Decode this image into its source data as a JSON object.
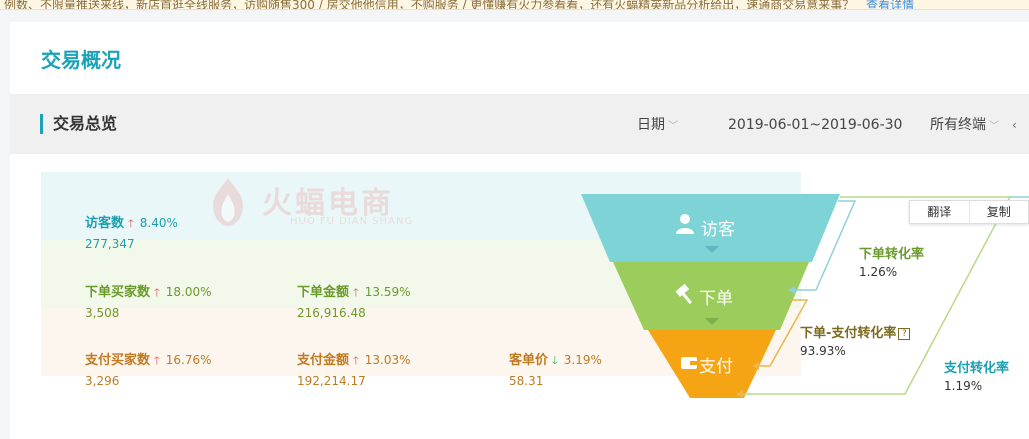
{
  "notice": {
    "text": "例数、不限量推送来线，新店首逛全线服务，访购随售300 / 房交他他信用，不购服务 / 更懂赚有火力参看看，还有火蝠精英新品分析给出，速通商交易意来事？",
    "link": "查看详情"
  },
  "page": {
    "title": "交易概况"
  },
  "section": {
    "title": "交易总览",
    "filters": {
      "date_label": "日期",
      "date_range": "2019-06-01~2019-06-30",
      "terminal": "所有终端"
    }
  },
  "watermark": {
    "title": "火蝠电商",
    "subtitle": "HUO FU DIAN SHANG"
  },
  "funnel": {
    "visitor": {
      "label": "访客",
      "color": "#7ed3d6"
    },
    "order": {
      "label": "下单",
      "color": "#9ccd5c"
    },
    "pay": {
      "label": "支付",
      "color": "#f5a414"
    }
  },
  "metrics": {
    "visitor": [
      {
        "label": "访客数",
        "direction": "up",
        "pct": "8.40%",
        "value": "277,347"
      }
    ],
    "order": [
      {
        "label": "下单买家数",
        "direction": "up",
        "pct": "18.00%",
        "value": "3,508"
      },
      {
        "label": "下单金额",
        "direction": "up",
        "pct": "13.59%",
        "value": "216,916.48"
      }
    ],
    "pay": [
      {
        "label": "支付买家数",
        "direction": "up",
        "pct": "16.76%",
        "value": "3,296"
      },
      {
        "label": "支付金额",
        "direction": "up",
        "pct": "13.03%",
        "value": "192,214.17"
      },
      {
        "label": "客单价",
        "direction": "down",
        "pct": "3.19%",
        "value": "58.31"
      }
    ]
  },
  "conversion": {
    "order_rate": {
      "label": "下单转化率",
      "value": "1.26%"
    },
    "order_to_pay_rate": {
      "label": "下单-支付转化率",
      "value": "93.93%"
    },
    "pay_rate": {
      "label": "支付转化率",
      "value": "1.19%"
    }
  },
  "context_menu": {
    "translate": "翻译",
    "copy": "复制"
  }
}
